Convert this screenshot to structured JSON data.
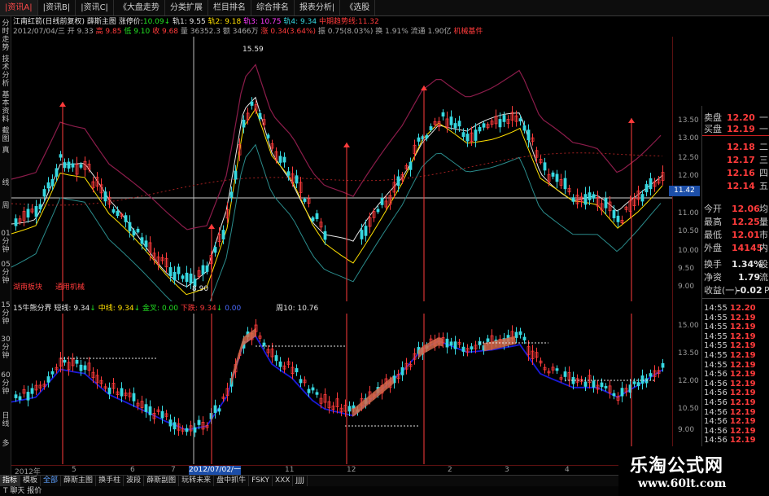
{
  "top_tabs": [
    "|资讯A|",
    "|资讯B|",
    "|资讯C|",
    "《大盘走势",
    "分类扩展",
    "栏目排名",
    "综合排名",
    "报表分析|",
    "《选股"
  ],
  "left_sidebar": [
    "分时走势",
    "技术分析",
    "基本资料",
    "截图",
    "真",
    "线",
    "周",
    "01分钟",
    "05分钟",
    "15分钟",
    "30分钟",
    "60分钟",
    "日线",
    "多"
  ],
  "info_line1": {
    "name": "江南红箭(日线前复权)",
    "indicator": "薛斯主图",
    "limit_label": "涨停价:",
    "limit_value": "10.09",
    "arrow1": "↓",
    "track1": "轨1: 9.55",
    "track2": "轨2: 9.18",
    "track3": "轨3: 10.75",
    "track4": "轨4: 9.34",
    "mid_label": "中期趋势线:",
    "mid_value": "11.32"
  },
  "info_line2": {
    "date": "2012/07/04/三",
    "open": "开 9.33",
    "high": "高 9.85",
    "low": "低 9.10",
    "close": "收 9.68",
    "volume": "量 36352.3",
    "amount": "额 3466万",
    "change": "涨 0.34(3.64%)",
    "amplitude": "振 0.75(8.03%)",
    "turnover": "换 1.91%",
    "float_value": "流通 1.90亿",
    "sector": "机械基件"
  },
  "chart_annotations": {
    "peak_label": "15.59",
    "low_label": "8.90",
    "sector_left": "湖南板块",
    "sector_right": "通用机械"
  },
  "sub_info": {
    "name": "15牛熊分界",
    "short_line": "短线: 9.34",
    "mid_line": "中线: 9.34",
    "golden_cross": "金叉: 0.00",
    "down": "下跌: 9.34",
    "mid_value": "0.00",
    "week10": "周10: 10.76"
  },
  "price_axis": {
    "main_ticks": [
      "13.50",
      "13.00",
      "12.50",
      "12.00",
      "11.50",
      "11.00",
      "10.50",
      "10.00",
      "9.50",
      "9.00"
    ],
    "current": "11.42",
    "sub_ticks": [
      "15.00",
      "13.50",
      "12.00",
      "10.50",
      "9.00"
    ]
  },
  "date_axis": {
    "start": "2012年",
    "ticks": [
      "5",
      "6",
      "7",
      "11",
      "12",
      "2",
      "3",
      "4"
    ],
    "highlight": "2012/07/02/一"
  },
  "order_book": [
    {
      "label": "卖盘",
      "value": "12.20",
      "extra": "一",
      "color": "#ff3b3b"
    },
    {
      "label": "买盘",
      "value": "12.19",
      "extra": "一",
      "color": "#ff3b3b"
    },
    {
      "label": "",
      "value": "12.18",
      "extra": "二",
      "color": "#ff3b3b"
    },
    {
      "label": "",
      "value": "12.17",
      "extra": "三",
      "color": "#ff3b3b"
    },
    {
      "label": "",
      "value": "12.16",
      "extra": "四",
      "color": "#ff3b3b"
    },
    {
      "label": "",
      "value": "12.14",
      "extra": "五",
      "color": "#ff3b3b"
    }
  ],
  "quote_stats": [
    {
      "label": "今开",
      "value": "12.06",
      "extra": "均",
      "color": "#ff3b3b"
    },
    {
      "label": "最高",
      "value": "12.25",
      "extra": "量",
      "color": "#ff3b3b"
    },
    {
      "label": "最低",
      "value": "12.01",
      "extra": "市",
      "color": "#ff3b3b"
    },
    {
      "label": "外盘",
      "value": "14145",
      "extra": "内",
      "color": "#ff3b3b"
    },
    {
      "label": "换手",
      "value": "1.34%",
      "extra": "股",
      "color": "#e6e6e6"
    },
    {
      "label": "净资",
      "value": "1.79",
      "extra": "流",
      "color": "#e6e6e6"
    },
    {
      "label": "收益(一)",
      "value": "-0.02",
      "extra": "PE",
      "color": "#e6e6e6"
    }
  ],
  "trades": [
    {
      "time": "14:55",
      "price": "12.20"
    },
    {
      "time": "14:55",
      "price": "12.19"
    },
    {
      "time": "14:55",
      "price": "12.19"
    },
    {
      "time": "14:55",
      "price": "12.19"
    },
    {
      "time": "14:55",
      "price": "12.19"
    },
    {
      "time": "14:55",
      "price": "12.19"
    },
    {
      "time": "14:55",
      "price": "12.19"
    },
    {
      "time": "14:56",
      "price": "12.19"
    },
    {
      "time": "14:56",
      "price": "12.19"
    },
    {
      "time": "14:56",
      "price": "12.19"
    },
    {
      "time": "14:56",
      "price": "12.19"
    },
    {
      "time": "14:56",
      "price": "12.19"
    },
    {
      "time": "14:56",
      "price": "12.19"
    },
    {
      "time": "14:56",
      "price": "12.19"
    },
    {
      "time": "14:56",
      "price": "12.19"
    }
  ],
  "bottom_tabs": [
    "指标",
    "模板",
    "全部",
    "薛斯主图",
    "换手柱",
    "波段",
    "薛斯副图",
    "玩转未来",
    "盘中抓牛",
    "FSKY",
    "XXX",
    "JJJJ"
  ],
  "status_text": "T 聊天 报价",
  "watermark": {
    "title": "乐淘公式网",
    "url": "www.60lt.com"
  },
  "colors": {
    "up": "#ff3b3b",
    "down": "#37d8e0",
    "band": "#8b1c4a",
    "line_white": "#e6e6e6",
    "line_yellow": "#ffe000",
    "cost_line": "#1a1ad8"
  }
}
